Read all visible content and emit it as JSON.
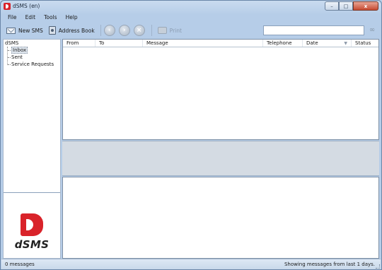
{
  "window": {
    "title": "dSMS (en)",
    "controls": {
      "minimize": "–",
      "maximize": "□",
      "close": "x"
    }
  },
  "menu": [
    {
      "label": "File"
    },
    {
      "label": "Edit"
    },
    {
      "label": "Tools"
    },
    {
      "label": "Help"
    }
  ],
  "toolbar": {
    "new_sms": "New SMS",
    "address_book": "Address Book",
    "print": "Print"
  },
  "search": {
    "value": "",
    "placeholder": ""
  },
  "tree": {
    "root": "dSMS",
    "items": [
      {
        "label": "Inbox",
        "selected": true
      },
      {
        "label": "Sent",
        "selected": false
      },
      {
        "label": "Service Requests",
        "selected": false
      }
    ]
  },
  "logo": {
    "text": "dSMS"
  },
  "grid": {
    "columns": [
      "From",
      "To",
      "Message",
      "Telephone",
      "Date",
      "Status"
    ],
    "rows": []
  },
  "status": {
    "left": "0 messages",
    "right": "Showing messages from last 1 days."
  },
  "colors": {
    "brand_red": "#d9232a",
    "window_frame": "#b6cde8"
  }
}
